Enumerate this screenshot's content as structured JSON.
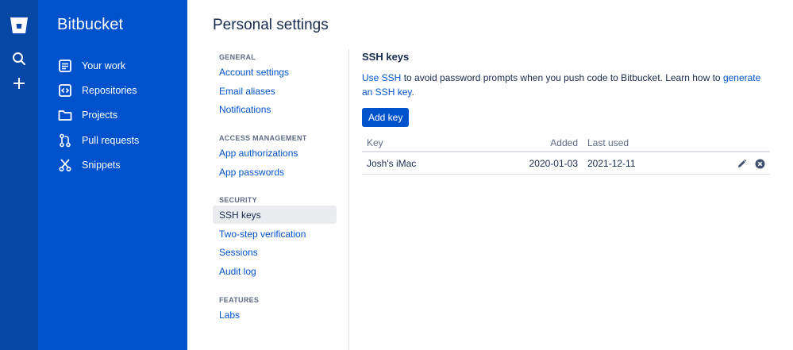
{
  "product": {
    "name": "Bitbucket"
  },
  "global_nav": {
    "icons": [
      "bitbucket-logo-icon",
      "search-icon",
      "create-plus-icon"
    ]
  },
  "product_nav": {
    "items": [
      {
        "label": "Your work",
        "icon": "your-work-icon"
      },
      {
        "label": "Repositories",
        "icon": "repositories-icon"
      },
      {
        "label": "Projects",
        "icon": "projects-folder-icon"
      },
      {
        "label": "Pull requests",
        "icon": "pull-requests-icon"
      },
      {
        "label": "Snippets",
        "icon": "snippets-scissors-icon"
      }
    ]
  },
  "page": {
    "title": "Personal settings"
  },
  "settings_nav": {
    "groups": [
      {
        "title": "GENERAL",
        "items": [
          "Account settings",
          "Email aliases",
          "Notifications"
        ]
      },
      {
        "title": "ACCESS MANAGEMENT",
        "items": [
          "App authorizations",
          "App passwords"
        ]
      },
      {
        "title": "SECURITY",
        "items": [
          "SSH keys",
          "Two-step verification",
          "Sessions",
          "Audit log"
        ]
      },
      {
        "title": "FEATURES",
        "items": [
          "Labs"
        ]
      }
    ],
    "active": "SSH keys"
  },
  "ssh": {
    "heading": "SSH keys",
    "desc_link1": "Use SSH",
    "desc_text": " to avoid password prompts when you push code to Bitbucket. Learn how to ",
    "desc_link2": "generate an SSH key",
    "desc_end": ".",
    "add_button": "Add key",
    "columns": {
      "key": "Key",
      "added": "Added",
      "last_used": "Last used"
    },
    "rows": [
      {
        "key": "Josh's iMac",
        "added": "2020-01-03",
        "last_used": "2021-12-11"
      }
    ]
  },
  "colors": {
    "global_nav": "#0747a6",
    "product_nav": "#0052cc",
    "link": "#0052cc",
    "active_bg": "#ebecf0"
  }
}
